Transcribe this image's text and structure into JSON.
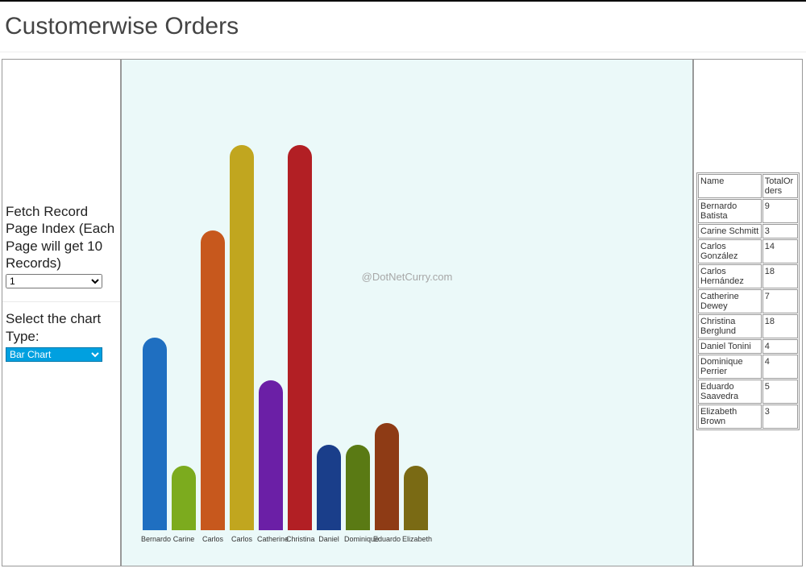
{
  "title": "Customerwise Orders",
  "watermark": "@DotNetCurry.com",
  "controls": {
    "page_index_label": "Fetch Record Page Index (Each Page will get 10 Records)",
    "page_index_selected": "1",
    "page_index_options": [
      "1"
    ],
    "chart_type_label": "Select the chart Type:",
    "chart_type_selected": "Bar Chart",
    "chart_type_options": [
      "Bar Chart"
    ]
  },
  "table": {
    "headers": [
      "Name",
      "TotalOrders"
    ],
    "rows": [
      {
        "name": "Bernardo Batista",
        "total": 9
      },
      {
        "name": "Carine Schmitt",
        "total": 3
      },
      {
        "name": "Carlos González",
        "total": 14
      },
      {
        "name": "Carlos Hernández",
        "total": 18
      },
      {
        "name": "Catherine Dewey",
        "total": 7
      },
      {
        "name": "Christina Berglund",
        "total": 18
      },
      {
        "name": "Daniel Tonini",
        "total": 4
      },
      {
        "name": "Dominique Perrier",
        "total": 4
      },
      {
        "name": "Eduardo Saavedra",
        "total": 5
      },
      {
        "name": "Elizabeth Brown",
        "total": 3
      }
    ]
  },
  "chart_data": {
    "type": "bar",
    "title": "",
    "xlabel": "",
    "ylabel": "",
    "ylim": [
      0,
      18
    ],
    "categories": [
      "Bernardo",
      "Carine",
      "Carlos",
      "Carlos",
      "Catherine",
      "Christina",
      "Daniel",
      "Dominique",
      "Eduardo",
      "Elizabeth"
    ],
    "values": [
      9,
      3,
      14,
      18,
      7,
      18,
      4,
      4,
      5,
      3
    ],
    "colors": [
      "#1f6fc1",
      "#7cab1e",
      "#c7581d",
      "#c1a61f",
      "#6b1fa6",
      "#b21f24",
      "#1a3e8a",
      "#5a7a14",
      "#8e3b15",
      "#7a6a14"
    ]
  }
}
